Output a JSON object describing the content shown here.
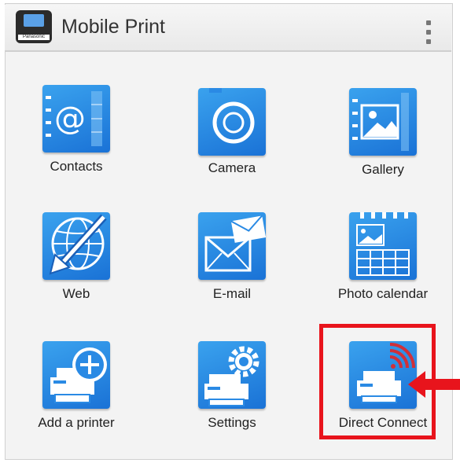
{
  "header": {
    "title": "Mobile Print",
    "logo_brand": "Panasonic"
  },
  "tiles": [
    {
      "label": "Contacts",
      "icon": "contacts-icon"
    },
    {
      "label": "Camera",
      "icon": "camera-icon"
    },
    {
      "label": "Gallery",
      "icon": "gallery-icon"
    },
    {
      "label": "Web",
      "icon": "web-globe-icon"
    },
    {
      "label": "E-mail",
      "icon": "email-icon"
    },
    {
      "label": "Photo calendar",
      "icon": "photo-calendar-icon"
    },
    {
      "label": "Add a printer",
      "icon": "add-printer-icon"
    },
    {
      "label": "Settings",
      "icon": "settings-gear-icon"
    },
    {
      "label": "Direct Connect",
      "icon": "direct-connect-printer-icon"
    }
  ],
  "colors": {
    "tile_blue": "#2a8ae4",
    "highlight_red": "#e8141c",
    "wifi_red": "#d0303a"
  }
}
